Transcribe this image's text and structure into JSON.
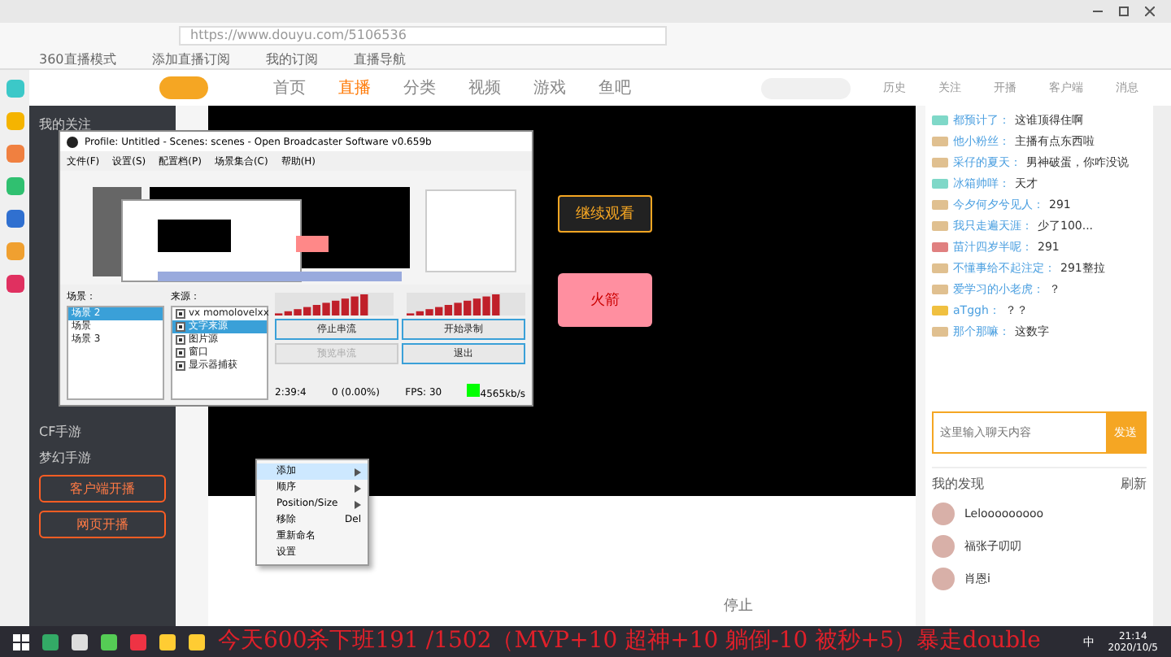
{
  "browser": {
    "address": "https://www.douyu.com/5106536",
    "bookmarks": [
      "360直播模式",
      "添加直播订阅",
      "我的订阅",
      "直播导航"
    ]
  },
  "site": {
    "nav": [
      {
        "label": "首页",
        "selected": false
      },
      {
        "label": "直播",
        "selected": true
      },
      {
        "label": "分类",
        "selected": false
      },
      {
        "label": "视频",
        "selected": false
      },
      {
        "label": "游戏",
        "selected": false
      },
      {
        "label": "鱼吧",
        "selected": false
      }
    ],
    "header_icons": [
      "历史",
      "关注",
      "开播",
      "客户端",
      "消息"
    ],
    "sidebar": {
      "follow": "我的关注",
      "items": [
        "CF手游",
        "梦幻手游"
      ],
      "buttons": [
        "客户端开播",
        "网页开播"
      ]
    },
    "video": {
      "continue_button": "继续观看",
      "promo": "火箭"
    },
    "stop_label": "停止",
    "chat": [
      {
        "user": "都预计了：",
        "text": "这谁顶得住啊",
        "color": "#7fd8c8"
      },
      {
        "user": "他小粉丝：",
        "text": "主播有点东西啦",
        "color": "#e0c090"
      },
      {
        "user": "采仔的夏天：",
        "text": "男神破蛋，你咋没说",
        "color": "#e0c090"
      },
      {
        "user": "冰箱帅咩：",
        "text": "天才",
        "color": "#7fd8c8"
      },
      {
        "user": "今夕何夕兮见人：",
        "text": "291",
        "color": "#e0c090"
      },
      {
        "user": "我只走遍天涯：",
        "text": "少了100...",
        "color": "#e0c090"
      },
      {
        "user": "苗汁四岁半呢：",
        "text": "291",
        "color": "#e08080"
      },
      {
        "user": "不懂事给不起注定：",
        "text": "291整拉",
        "color": "#e0c090"
      },
      {
        "user": "爱学习的小老虎：",
        "text": "？",
        "color": "#e0c090"
      },
      {
        "user": "aTggh：",
        "text": "？？",
        "color": "#f0c040"
      },
      {
        "user": "那个那嘛：",
        "text": "这数字",
        "color": "#e0c090"
      }
    ],
    "chat_input": {
      "placeholder": "这里输入聊天内容",
      "send": "发送"
    },
    "discover": {
      "title": "我的发现",
      "refresh": "刷新",
      "users": [
        "Lelooooooooo",
        "福张子叨叨",
        "肖恩i"
      ]
    }
  },
  "obs": {
    "title": "Profile: Untitled - Scenes: scenes - Open Broadcaster Software v0.659b",
    "menu": [
      "文件(F)",
      "设置(S)",
      "配置档(P)",
      "场景集合(C)",
      "帮助(H)"
    ],
    "scenes_label": "场景：",
    "sources_label": "来源：",
    "scenes": [
      {
        "label": "场景 2",
        "selected": true
      },
      {
        "label": "场景",
        "selected": false
      },
      {
        "label": "场景 3",
        "selected": false
      }
    ],
    "sources": [
      {
        "label": "vx momolovelxx",
        "selected": false,
        "checked": true
      },
      {
        "label": "文字来源",
        "selected": true,
        "checked": true
      },
      {
        "label": "图片源",
        "selected": false,
        "checked": true
      },
      {
        "label": "窗口",
        "selected": false,
        "checked": true
      },
      {
        "label": "显示器捕获",
        "selected": false,
        "checked": true
      }
    ],
    "buttons": [
      {
        "label": "停止串流",
        "disabled": false
      },
      {
        "label": "开始录制",
        "disabled": false
      },
      {
        "label": "预览串流",
        "disabled": true
      },
      {
        "label": "退出",
        "disabled": false
      }
    ],
    "mic": {
      "level": 0.8
    },
    "speaker": {
      "level": 0.8
    },
    "status": [
      "2:39:4",
      "0 (0.00%)",
      "FPS: 30",
      "4565kb/s"
    ]
  },
  "context_menu": [
    {
      "label": "添加",
      "submenu": true,
      "selected": true
    },
    {
      "label": "顺序",
      "submenu": true,
      "selected": false
    },
    {
      "label": "Position/Size",
      "submenu": true,
      "selected": false
    },
    {
      "label": "移除",
      "shortcut": "Del",
      "submenu": false,
      "selected": false
    },
    {
      "label": "重新命名",
      "submenu": false,
      "selected": false
    },
    {
      "label": "设置",
      "submenu": false,
      "selected": false
    }
  ],
  "caption": "今天600杀下班191 /1502（MVP+10 超神+10 躺倒-10 被秒+5）暴走double",
  "taskbar": {
    "ime": "中",
    "time": "21:14",
    "date": "2020/10/5"
  }
}
